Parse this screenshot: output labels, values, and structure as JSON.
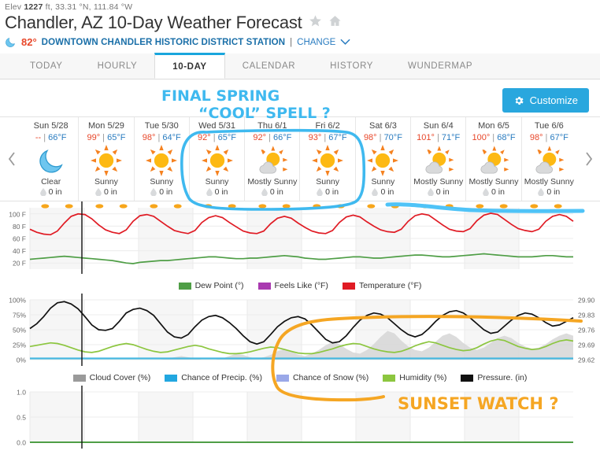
{
  "header": {
    "elev_prefix": "Elev ",
    "elev_value": "1227",
    "elev_suffix": " ft, 33.31 °N, 111.84 °W",
    "title": "Chandler, AZ 10-Day Weather Forecast",
    "star_icon": "star-icon",
    "home_icon": "home-icon",
    "current_temp": "82°",
    "station": "DOWNTOWN CHANDLER HISTORIC DISTRICT STATION",
    "divider": "|",
    "change_label": "CHANGE",
    "chevron": "⌄"
  },
  "tabs": [
    {
      "label": "TODAY",
      "active": false
    },
    {
      "label": "HOURLY",
      "active": false
    },
    {
      "label": "10-DAY",
      "active": true
    },
    {
      "label": "CALENDAR",
      "active": false
    },
    {
      "label": "HISTORY",
      "active": false
    },
    {
      "label": "WUNDERMAP",
      "active": false
    }
  ],
  "toolbar": {
    "customize_label": "Customize"
  },
  "nav": {
    "prev": "‹",
    "next": "›"
  },
  "forecast_days": [
    {
      "date": "Sun 5/28",
      "high": "--",
      "low": "66°F",
      "icon": "moon-clear",
      "cond": "Clear",
      "precip": "0 in"
    },
    {
      "date": "Mon 5/29",
      "high": "99°",
      "low": "65°F",
      "icon": "sunny",
      "cond": "Sunny",
      "precip": "0 in"
    },
    {
      "date": "Tue 5/30",
      "high": "98°",
      "low": "64°F",
      "icon": "sunny",
      "cond": "Sunny",
      "precip": "0 in"
    },
    {
      "date": "Wed 5/31",
      "high": "92°",
      "low": "65°F",
      "icon": "sunny",
      "cond": "Sunny",
      "precip": "0 in"
    },
    {
      "date": "Thu 6/1",
      "high": "92°",
      "low": "66°F",
      "icon": "mostly-sunny",
      "cond": "Mostly Sunny",
      "precip": "0 in"
    },
    {
      "date": "Fri 6/2",
      "high": "93°",
      "low": "67°F",
      "icon": "sunny",
      "cond": "Sunny",
      "precip": "0 in"
    },
    {
      "date": "Sat 6/3",
      "high": "98°",
      "low": "70°F",
      "icon": "sunny",
      "cond": "Sunny",
      "precip": "0 in"
    },
    {
      "date": "Sun 6/4",
      "high": "101°",
      "low": "71°F",
      "icon": "mostly-sunny",
      "cond": "Mostly Sunny",
      "precip": "0 in"
    },
    {
      "date": "Mon 6/5",
      "high": "100°",
      "low": "68°F",
      "icon": "mostly-sunny",
      "cond": "Mostly Sunny",
      "precip": "0 in"
    },
    {
      "date": "Tue 6/6",
      "high": "98°",
      "low": "67°F",
      "icon": "mostly-sunny",
      "cond": "Mostly Sunny",
      "precip": "0 in"
    }
  ],
  "annotations": [
    {
      "id": "ann-cool-spell",
      "text_line1": "FINAL SPRING",
      "text_line2": "“COOL” SPELL ?",
      "color": "#3fb9ef"
    },
    {
      "id": "ann-sunset-watch",
      "text": "SUNSET WATCH ?",
      "color": "#f5a623"
    }
  ],
  "chart_data": [
    {
      "type": "line",
      "name": "temperature-chart",
      "title": "",
      "xlabel": "",
      "ylabel": "",
      "ylim": [
        10,
        110
      ],
      "yticks": [
        100,
        80,
        60,
        40,
        20
      ],
      "ytick_labels": [
        "100 F",
        "80 F",
        "60 F",
        "40 F",
        "20 F"
      ],
      "grid": true,
      "legend_position": "bottom",
      "legend": [
        {
          "label": "Dew Point (°)",
          "color": "#4f9e46"
        },
        {
          "label": "Feels Like (°F)",
          "color": "#a93ab0"
        },
        {
          "label": "Temperature (°F)",
          "color": "#e01b24"
        }
      ],
      "series": [
        {
          "name": "Temperature (°F)",
          "color": "#e01b24",
          "values": [
            75,
            70,
            67,
            66,
            72,
            85,
            96,
            100,
            99,
            92,
            82,
            74,
            70,
            68,
            74,
            88,
            97,
            99,
            96,
            88,
            80,
            73,
            70,
            68,
            73,
            86,
            94,
            97,
            94,
            86,
            79,
            72,
            69,
            68,
            72,
            84,
            93,
            96,
            93,
            85,
            78,
            72,
            69,
            68,
            73,
            86,
            95,
            98,
            95,
            87,
            80,
            74,
            71,
            70,
            75,
            88,
            97,
            100,
            98,
            90,
            82,
            75,
            72,
            71,
            76,
            89,
            98,
            101,
            99,
            91,
            83,
            76,
            73,
            71,
            75,
            88,
            96,
            99,
            96,
            88
          ]
        },
        {
          "name": "Dew Point (°)",
          "color": "#4f9e46",
          "values": [
            26,
            27,
            28,
            29,
            30,
            31,
            30,
            29,
            28,
            27,
            26,
            25,
            24,
            22,
            20,
            19,
            21,
            22,
            23,
            24,
            24,
            25,
            26,
            27,
            28,
            29,
            30,
            30,
            29,
            28,
            27,
            27,
            28,
            28,
            29,
            30,
            31,
            32,
            31,
            30,
            28,
            27,
            26,
            26,
            27,
            28,
            29,
            30,
            30,
            29,
            28,
            28,
            29,
            30,
            31,
            32,
            33,
            33,
            32,
            31,
            30,
            30,
            31,
            32,
            33,
            34,
            35,
            34,
            33,
            32,
            31,
            30,
            30,
            30,
            31,
            32,
            32,
            31,
            30,
            30
          ]
        },
        {
          "name": "Feels Like (°F)",
          "color": "#a93ab0",
          "values": []
        }
      ]
    },
    {
      "type": "line",
      "name": "humidity-pressure-chart",
      "ylim_left": [
        0,
        100
      ],
      "yticks_left": [
        100,
        75,
        50,
        25,
        0
      ],
      "ytick_labels_left": [
        "100%",
        "75%",
        "50%",
        "25%",
        "0%"
      ],
      "ylim_right": [
        29.62,
        29.9
      ],
      "yticks_right": [
        29.9,
        29.83,
        29.76,
        29.69,
        29.62
      ],
      "ytick_labels_right": [
        "29.90",
        "29.83",
        "29.76",
        "29.69",
        "29.62"
      ],
      "grid": true,
      "legend_position": "bottom",
      "legend": [
        {
          "label": "Cloud Cover (%)",
          "color": "#9a9a9a"
        },
        {
          "label": "Chance of Precip. (%)",
          "color": "#22a7e0"
        },
        {
          "label": "Chance of Snow (%)",
          "color": "#9aa8e8"
        },
        {
          "label": "Humidity (%)",
          "color": "#8cc63f"
        },
        {
          "label": "Pressure. (in)",
          "color": "#111111"
        }
      ],
      "series": [
        {
          "name": "Pressure. (in)",
          "color": "#111111",
          "values": [
            52,
            60,
            72,
            86,
            95,
            97,
            93,
            85,
            72,
            58,
            50,
            49,
            52,
            64,
            78,
            84,
            86,
            82,
            74,
            60,
            46,
            38,
            36,
            42,
            55,
            66,
            72,
            74,
            70,
            62,
            52,
            40,
            30,
            26,
            30,
            42,
            55,
            64,
            70,
            72,
            68,
            58,
            46,
            34,
            28,
            30,
            40,
            54,
            66,
            74,
            78,
            76,
            70,
            60,
            50,
            42,
            38,
            42,
            52,
            64,
            74,
            80,
            82,
            78,
            70,
            60,
            50,
            44,
            46,
            56,
            66,
            74,
            78,
            76,
            70,
            62,
            56,
            58,
            64,
            70
          ]
        },
        {
          "name": "Humidity (%)",
          "color": "#8cc63f",
          "values": [
            22,
            24,
            26,
            28,
            27,
            24,
            20,
            16,
            13,
            12,
            14,
            18,
            22,
            25,
            27,
            25,
            21,
            17,
            14,
            12,
            13,
            16,
            19,
            22,
            24,
            22,
            18,
            15,
            12,
            10,
            10,
            11,
            13,
            16,
            19,
            21,
            20,
            17,
            14,
            11,
            10,
            10,
            12,
            15,
            18,
            22,
            25,
            27,
            26,
            22,
            18,
            15,
            13,
            12,
            14,
            18,
            23,
            27,
            30,
            28,
            24,
            20,
            17,
            15,
            16,
            20,
            26,
            31,
            34,
            32,
            27,
            22,
            19,
            17,
            18,
            22,
            27,
            31,
            33,
            31
          ]
        },
        {
          "name": "Cloud Cover (%)",
          "color": "#c9c9c9",
          "values": [
            0,
            0,
            0,
            0,
            0,
            0,
            0,
            0,
            0,
            0,
            0,
            0,
            0,
            0,
            0,
            0,
            0,
            0,
            0,
            0,
            2,
            4,
            6,
            4,
            2,
            0,
            0,
            0,
            2,
            6,
            10,
            8,
            4,
            2,
            4,
            8,
            14,
            18,
            14,
            8,
            6,
            10,
            16,
            24,
            30,
            26,
            18,
            12,
            10,
            16,
            26,
            38,
            48,
            44,
            32,
            22,
            16,
            14,
            20,
            30,
            40,
            44,
            38,
            28,
            20,
            16,
            20,
            28,
            36,
            40,
            36,
            28,
            22,
            18,
            20,
            26,
            34,
            40,
            44,
            40
          ]
        },
        {
          "name": "Chance of Precip. (%)",
          "color": "#22a7e0",
          "values": [
            2,
            2,
            2,
            2,
            2,
            2,
            2,
            2,
            2,
            2,
            2,
            2,
            2,
            2,
            2,
            2,
            2,
            2,
            2,
            2,
            2,
            2,
            2,
            2,
            2,
            2,
            2,
            2,
            2,
            2,
            2,
            2,
            2,
            2,
            2,
            2,
            2,
            2,
            2,
            2,
            2,
            2,
            2,
            2,
            2,
            2,
            2,
            2,
            2,
            2,
            2,
            2,
            2,
            2,
            2,
            2,
            2,
            2,
            2,
            2,
            2,
            2,
            2,
            2,
            2,
            2,
            2,
            2,
            2,
            2,
            2,
            2,
            2,
            2,
            2,
            2,
            2,
            2,
            2,
            2
          ]
        },
        {
          "name": "Chance of Snow (%)",
          "color": "#9aa8e8",
          "values": []
        }
      ]
    },
    {
      "type": "line",
      "name": "precip-accumulation-chart",
      "ylim": [
        0,
        1
      ],
      "yticks": [
        1.0,
        0.5,
        0.0
      ],
      "ytick_labels": [
        "1.0",
        "0.5",
        "0.0"
      ],
      "grid": true,
      "series": [
        {
          "name": "Accumulation",
          "color": "#4f9e46",
          "values": [
            0,
            0,
            0,
            0,
            0,
            0,
            0,
            0,
            0,
            0,
            0,
            0,
            0,
            0,
            0,
            0,
            0,
            0,
            0,
            0,
            0,
            0,
            0,
            0,
            0,
            0,
            0,
            0,
            0,
            0,
            0,
            0,
            0,
            0,
            0,
            0,
            0,
            0,
            0,
            0,
            0,
            0,
            0,
            0,
            0,
            0,
            0,
            0,
            0,
            0,
            0,
            0,
            0,
            0,
            0,
            0,
            0,
            0,
            0,
            0,
            0,
            0,
            0,
            0,
            0,
            0,
            0,
            0,
            0,
            0,
            0,
            0,
            0,
            0,
            0,
            0,
            0,
            0,
            0,
            0
          ]
        }
      ]
    }
  ]
}
